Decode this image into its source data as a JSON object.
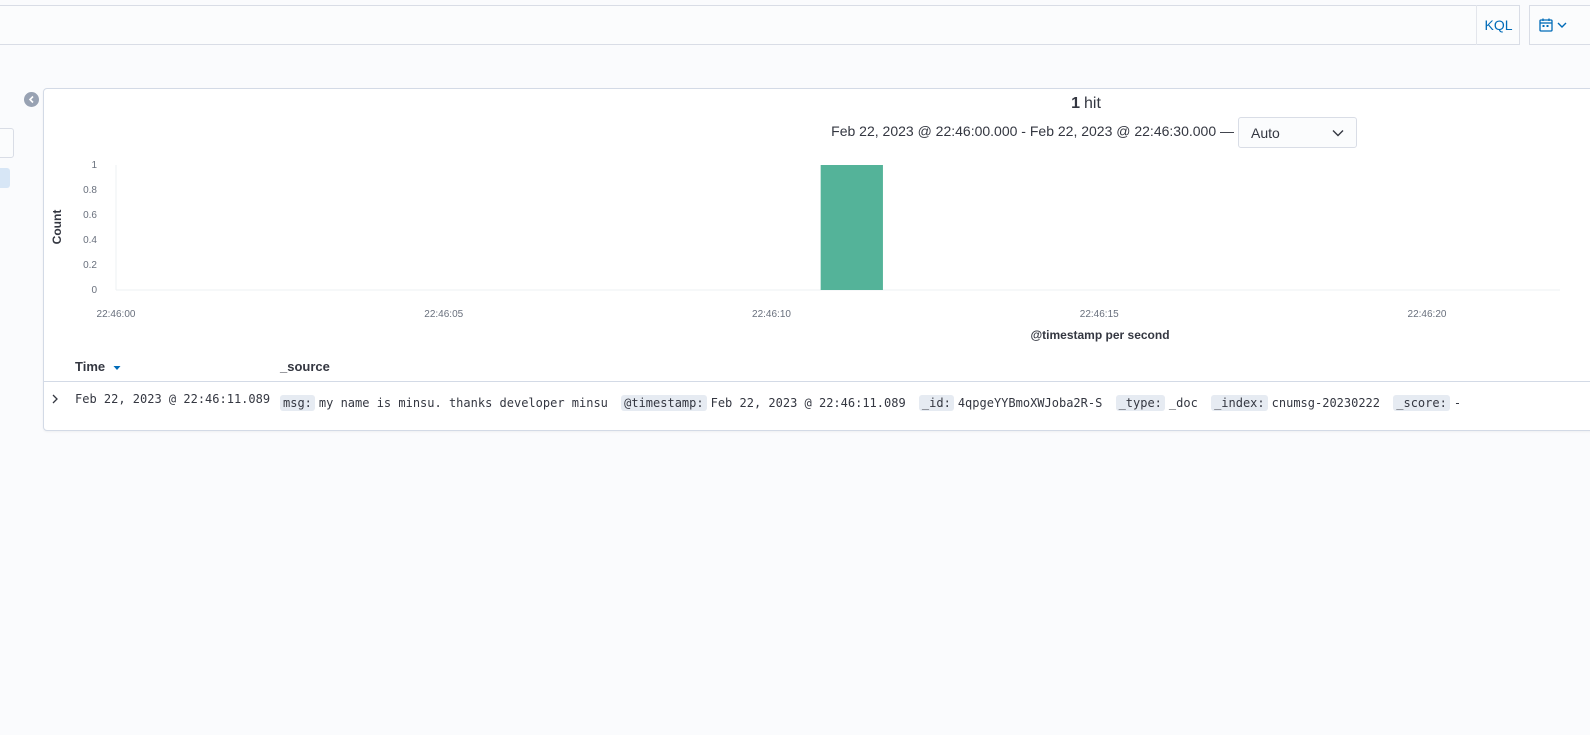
{
  "query_bar": {
    "language_label": "KQL"
  },
  "panel": {
    "hits_count": "1",
    "hits_label": "hit",
    "time_range": "Feb 22, 2023 @ 22:46:00.000 - Feb 22, 2023 @ 22:46:30.000 —",
    "interval_value": "Auto"
  },
  "chart_data": {
    "type": "bar",
    "ylabel": "Count",
    "xlabel": "@timestamp per second",
    "y_ticks": [
      "0",
      "0.2",
      "0.4",
      "0.6",
      "0.8",
      "1"
    ],
    "ylim": [
      0,
      1
    ],
    "x_ticks": [
      "22:46:00",
      "22:46:05",
      "22:46:10",
      "22:46:15",
      "22:46:20"
    ],
    "series": [
      {
        "x": [
          "22:46:11"
        ],
        "values": [
          1
        ]
      }
    ],
    "bar_color": "#54b399",
    "grid": false
  },
  "table": {
    "headers": {
      "time": "Time",
      "source": "_source"
    },
    "rows": [
      {
        "time": "Feb 22, 2023 @ 22:46:11.089",
        "fields": [
          {
            "key": "msg:",
            "value": "my name is minsu. thanks developer minsu"
          },
          {
            "key": "@timestamp:",
            "value": "Feb 22, 2023 @ 22:46:11.089"
          },
          {
            "key": "_id:",
            "value": "4qpgeYYBmoXWJoba2R-S"
          },
          {
            "key": "_type:",
            "value": "_doc"
          },
          {
            "key": "_index:",
            "value": "cnumsg-20230222"
          },
          {
            "key": "_score:",
            "value": "-"
          }
        ]
      }
    ]
  },
  "colors": {
    "accent": "#006bb8",
    "bar": "#54b399",
    "field_key_bg": "#e6ebf2"
  }
}
